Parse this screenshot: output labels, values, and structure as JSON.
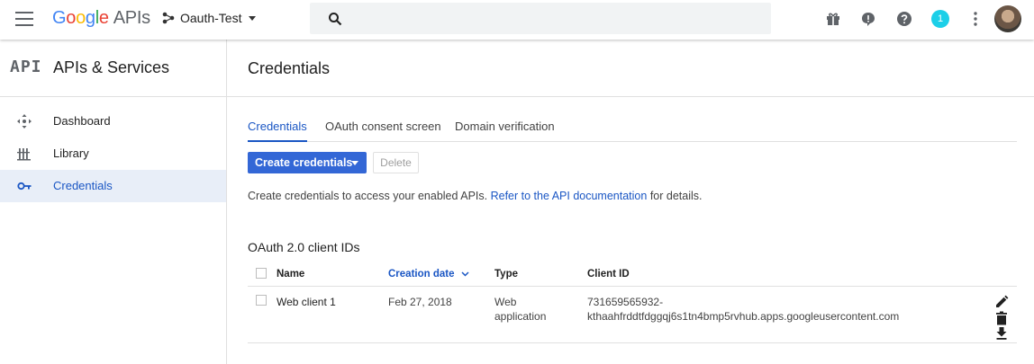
{
  "header": {
    "logo_letters": [
      "G",
      "o",
      "o",
      "g",
      "l",
      "e"
    ],
    "logo_suffix": "APIs",
    "project_name": "Oauth-Test",
    "search_placeholder": "",
    "notification_count": "1",
    "icons": [
      "menu-icon",
      "project-icon",
      "search-icon",
      "gift-icon",
      "feedback-icon",
      "help-icon",
      "notifications-icon",
      "more-vert-icon",
      "account-avatar"
    ]
  },
  "sidebar": {
    "logo": "API",
    "title": "APIs & Services",
    "items": [
      {
        "label": "Dashboard",
        "icon": "dashboard-icon",
        "active": false
      },
      {
        "label": "Library",
        "icon": "library-icon",
        "active": false
      },
      {
        "label": "Credentials",
        "icon": "key-icon",
        "active": true
      }
    ]
  },
  "main": {
    "title": "Credentials",
    "tabs": [
      {
        "label": "Credentials",
        "active": true
      },
      {
        "label": "OAuth consent screen",
        "active": false
      },
      {
        "label": "Domain verification",
        "active": false
      }
    ],
    "create_button": "Create credentials",
    "delete_button": "Delete",
    "info_prefix": "Create credentials to access your enabled APIs.",
    "info_link": "Refer to the API documentation",
    "info_suffix": "for details.",
    "section_title": "OAuth 2.0 client IDs",
    "table": {
      "columns": [
        "Name",
        "Creation date",
        "Type",
        "Client ID"
      ],
      "sorted_column": "Creation date",
      "rows": [
        {
          "name": "Web client 1",
          "date": "Feb 27, 2018",
          "type_line1": "Web",
          "type_line2": "application",
          "client_id_line1": "731659565932-",
          "client_id_line2": "kthaahfrddtfdggqj6s1tn4bmp5rvhub.apps.googleusercontent.com"
        }
      ]
    }
  },
  "colors": {
    "accent": "#3367d6",
    "link": "#1a56c4",
    "active_nav_bg": "#e8eef8",
    "notification_badge": "#1ccfe8"
  }
}
